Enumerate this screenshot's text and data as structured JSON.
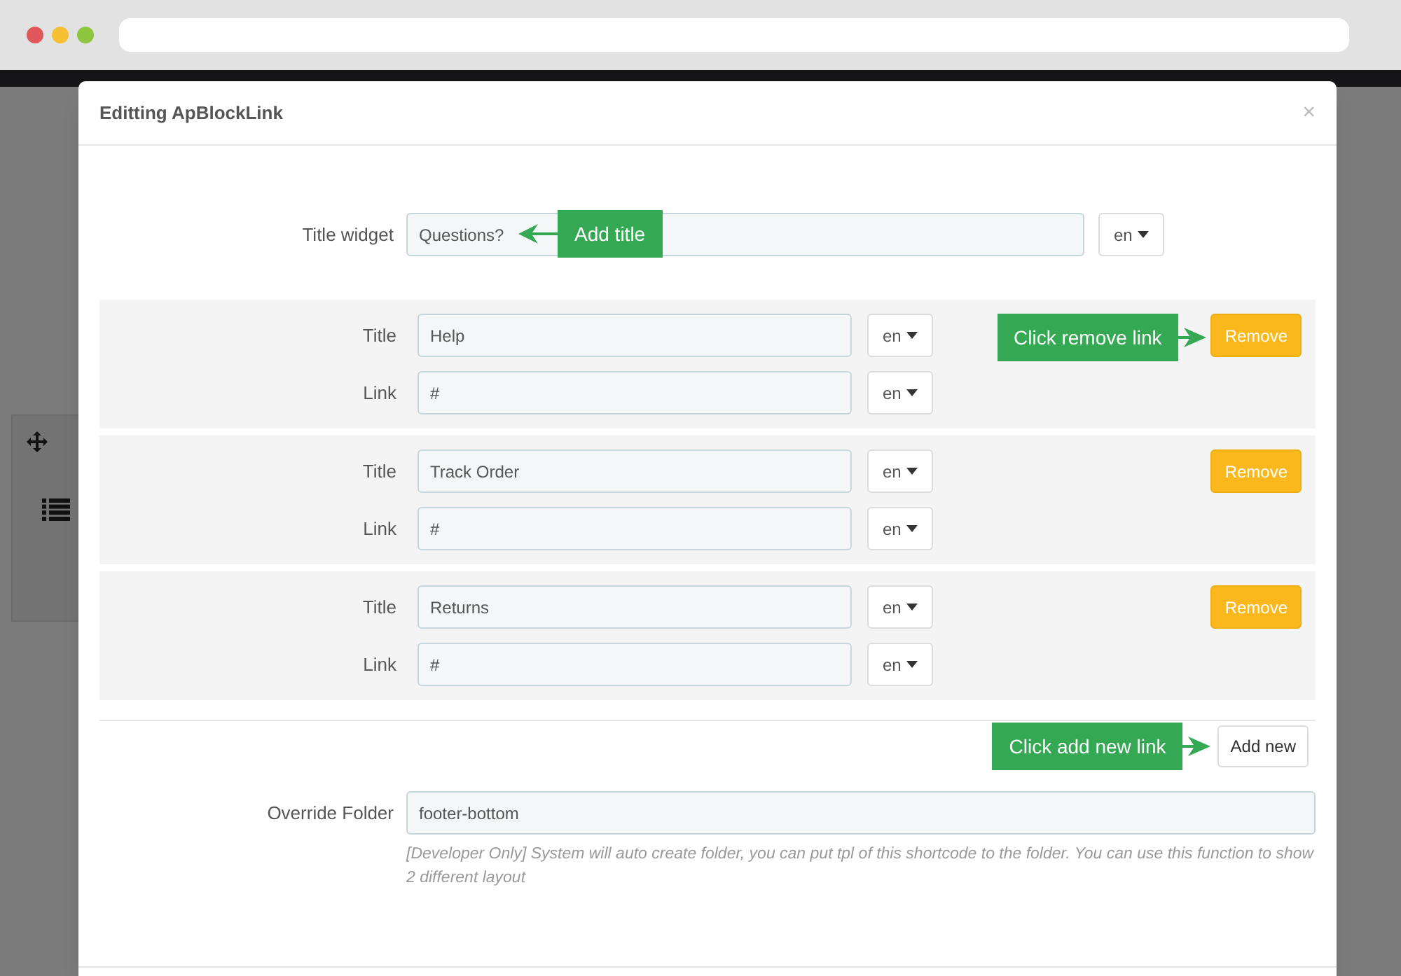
{
  "modal": {
    "title": "Editting ApBlockLink",
    "close": "×"
  },
  "title_widget": {
    "label": "Title widget",
    "value": "Questions?",
    "lang": "en",
    "callout": "Add title"
  },
  "links": [
    {
      "title_label": "Title",
      "title_value": "Help",
      "title_lang": "en",
      "link_label": "Link",
      "link_value": "#",
      "link_lang": "en",
      "remove": "Remove",
      "callout": "Click remove link"
    },
    {
      "title_label": "Title",
      "title_value": "Track Order",
      "title_lang": "en",
      "link_label": "Link",
      "link_value": "#",
      "link_lang": "en",
      "remove": "Remove"
    },
    {
      "title_label": "Title",
      "title_value": "Returns",
      "title_lang": "en",
      "link_label": "Link",
      "link_value": "#",
      "link_lang": "en",
      "remove": "Remove"
    }
  ],
  "add_new": {
    "label": "Add new",
    "callout": "Click add new link"
  },
  "override_folder": {
    "label": "Override Folder",
    "value": "footer-bottom",
    "help": "[Developer Only] System will auto create folder, you can put tpl of this shortcode to the folder. You can use this function to show 2 different layout"
  }
}
